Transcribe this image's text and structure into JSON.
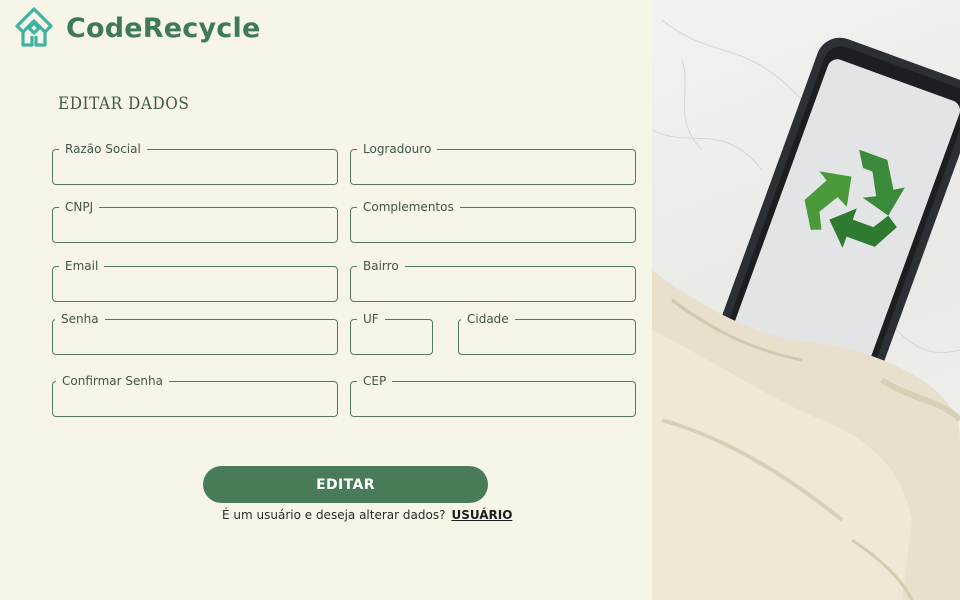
{
  "brand": {
    "name": "CodeRecycle"
  },
  "form": {
    "title": "EDITAR DADOS",
    "fields": {
      "razao_social": "Razão Social",
      "logradouro": "Logradouro",
      "cnpj": "CNPJ",
      "complementos": "Complementos",
      "email": "Email",
      "bairro": "Bairro",
      "senha": "Senha",
      "uf": "UF",
      "cidade": "Cidade",
      "confirmar_senha": "Confirmar Senha",
      "cep": "CEP"
    },
    "submit_label": "EDITAR",
    "footer_prompt": "É um usuário e deseja alterar dados?",
    "footer_link": "USUÁRIO"
  },
  "colors": {
    "accent": "#487c58",
    "brand": "#3f7a56",
    "background": "#f6f5e8",
    "field_border": "#56785f"
  },
  "icons": {
    "brand_logo": "recycle-house-logo-icon",
    "hero_recycle": "recycle-icon"
  }
}
